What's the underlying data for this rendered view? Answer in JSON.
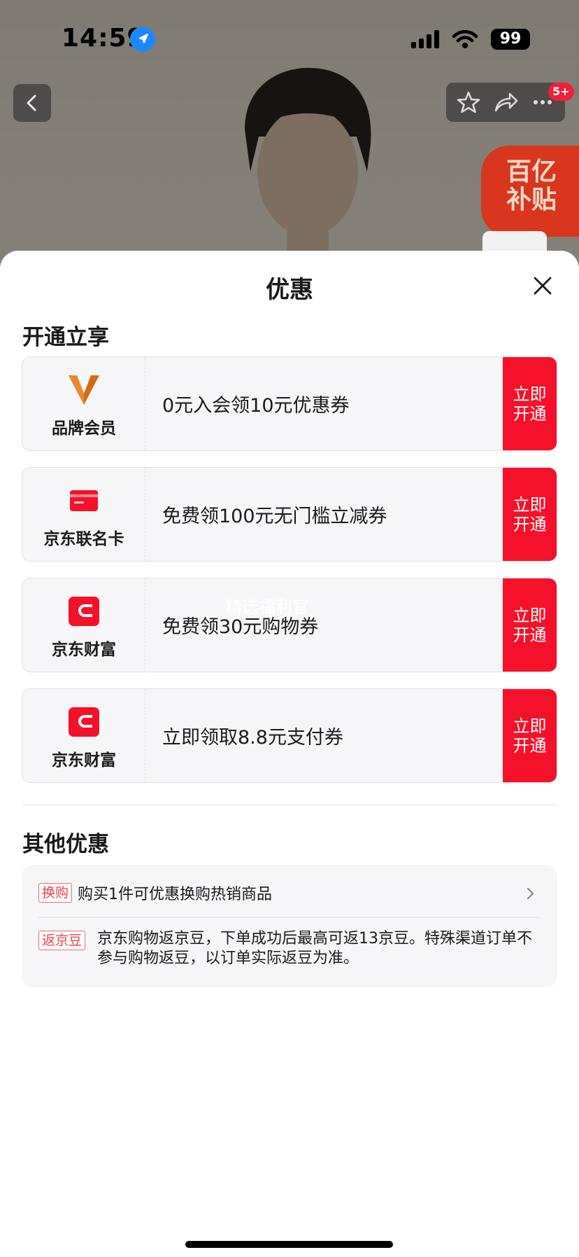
{
  "status_bar": {
    "time": "14:59",
    "battery": "99"
  },
  "header": {
    "message_badge": "5+",
    "subsidy_badge": [
      "百亿",
      "补贴"
    ]
  },
  "sheet": {
    "title": "优惠",
    "section_open": "开通立享",
    "offers": [
      {
        "name": "品牌会员",
        "description": "0元入会领10元优惠券",
        "action": [
          "立即",
          "开通"
        ],
        "logo": "brand-member-v-icon"
      },
      {
        "name": "京东联名卡",
        "description": "免费领100元无门槛立减券",
        "action": [
          "立即",
          "开通"
        ],
        "logo": "jd-cobrand-card-icon"
      },
      {
        "name": "京东财富",
        "description": "免费领30元购物券",
        "action": [
          "立即",
          "开通"
        ],
        "logo": "jd-wealth-wallet-icon"
      },
      {
        "name": "京东财富",
        "description": "立即领取8.8元支付券",
        "action": [
          "立即",
          "开通"
        ],
        "logo": "jd-wealth-wallet-icon"
      }
    ],
    "watermark": "精选福利官",
    "section_other": "其他优惠",
    "other_offers": [
      {
        "tag": "换购",
        "text": "购买1件可优惠换购热销商品"
      },
      {
        "tag": "返京豆",
        "text": "京东购物返京豆，下单成功后最高可返13京豆。特殊渠道订单不参与购物返豆，以订单实际返豆为准。"
      }
    ]
  },
  "colors": {
    "accent_red": "#f5112a",
    "card_bg": "#f6f6f8",
    "tag_red": "#f03c4a",
    "brand_orange": "#d46a17"
  }
}
